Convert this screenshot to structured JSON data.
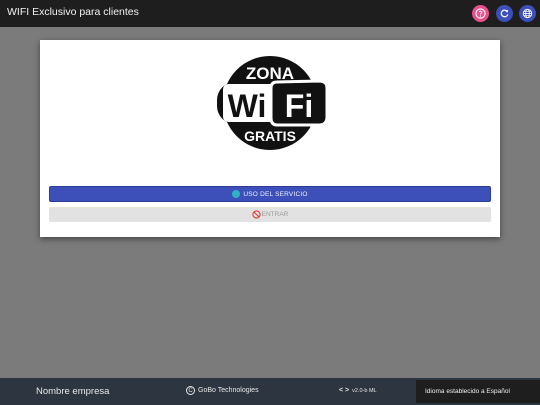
{
  "header": {
    "title": "WIFI Exclusivo para clientes",
    "help_icon": "help-circle-icon",
    "refresh_icon": "refresh-icon",
    "language_icon": "globe-icon",
    "help_color": "#e94f8b",
    "refresh_color": "#3d4fb8",
    "language_color": "#3d4fb8"
  },
  "logo": {
    "top_text": "ZONA",
    "wi_text": "Wi",
    "fi_text": "Fi",
    "bottom_text": "GRATIS"
  },
  "buttons": {
    "uso_label": "USO DEL SERVICIO",
    "uso_icon": "info-dot-icon",
    "entrar_label": "ENTRAR",
    "entrar_icon": "block-icon",
    "accent_color": "#3d4fb8"
  },
  "footer": {
    "company": "Nombre empresa",
    "copyright": "GoBo Technologies",
    "version": "v2.0-b ML",
    "toast": "Idioma establecido a Español"
  }
}
